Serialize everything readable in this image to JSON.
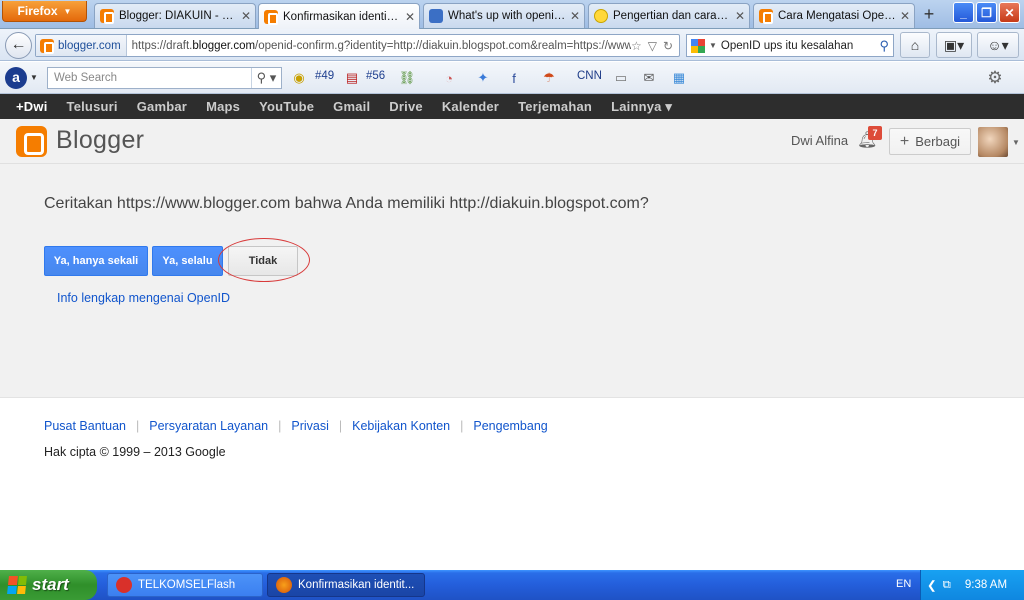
{
  "browser": {
    "menu_label": "Firefox",
    "tabs": [
      {
        "label": "Blogger: DIAKUIN - Edit...",
        "icon": "blogger-icon"
      },
      {
        "label": "Konfirmasikan identitas ...",
        "icon": "blogger-icon",
        "active": true
      },
      {
        "label": "What's up with openid. ...",
        "icon": "chat-icon"
      },
      {
        "label": "Pengertian dan cara m...",
        "icon": "smiley-icon"
      },
      {
        "label": "Cara Mengatasi OpenI...",
        "icon": "blogger-icon"
      }
    ],
    "new_tab": "+",
    "site_identity": "blogger.com",
    "url_prefix": "https://draft.",
    "url_domain": "blogger.com",
    "url_rest": "/openid-confirm.g?identity=http://diakuin.blogspot.com&realm=https://www",
    "search_query": "OpenID ups itu kesalahan"
  },
  "ask_toolbar": {
    "placeholder": "Web Search",
    "item1": "#49",
    "item2": "#56",
    "cnn": "CNN"
  },
  "google_bar": {
    "items": [
      "+Dwi",
      "Telusuri",
      "Gambar",
      "Maps",
      "YouTube",
      "Gmail",
      "Drive",
      "Kalender",
      "Terjemahan",
      "Lainnya ▾"
    ]
  },
  "blogger": {
    "brand": "Blogger",
    "user": "Dwi Alfina",
    "notif_count": "7",
    "share_label": "Berbagi"
  },
  "confirm": {
    "question": "Ceritakan https://www.blogger.com bahwa Anda memiliki http://diakuin.blogspot.com?",
    "btn_once": "Ya, hanya sekali",
    "btn_always": "Ya, selalu",
    "btn_no": "Tidak",
    "info_link": "Info lengkap mengenai OpenID"
  },
  "footer": {
    "links": [
      "Pusat Bantuan",
      "Persyaratan Layanan",
      "Privasi",
      "Kebijakan Konten",
      "Pengembang"
    ],
    "copyright": "Hak cipta © 1999 – 2013 Google"
  },
  "taskbar": {
    "start": "start",
    "tasks": [
      "TELKOMSELFlash",
      "Konfirmasikan identit..."
    ],
    "lang": "EN",
    "time": "9:38 AM"
  },
  "colors": {
    "blogger_orange": "#f57d00",
    "action_blue": "#4d90fe",
    "link_blue": "#1155cc",
    "highlight_red": "#d83a3a"
  }
}
